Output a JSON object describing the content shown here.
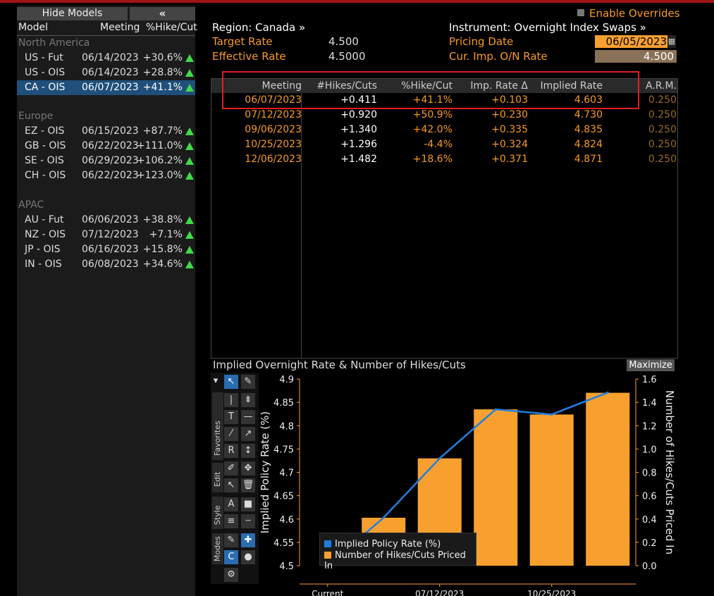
{
  "left": {
    "hide_label": "Hide Models",
    "collapse_label": "«",
    "columns": {
      "model": "Model",
      "meeting": "Meeting",
      "pct": "%Hike/Cut"
    },
    "groups": [
      {
        "name": "North America",
        "rows": [
          {
            "model": "US - Fut",
            "meeting": "06/14/2023",
            "pct": "+30.6%"
          },
          {
            "model": "US - OIS",
            "meeting": "06/14/2023",
            "pct": "+28.8%"
          },
          {
            "model": "CA - OIS",
            "meeting": "06/07/2023",
            "pct": "+41.1%"
          }
        ]
      },
      {
        "name": "Europe",
        "rows": [
          {
            "model": "EZ - OIS",
            "meeting": "06/15/2023",
            "pct": "+87.7%"
          },
          {
            "model": "GB - OIS",
            "meeting": "06/22/2023",
            "pct": "+111.0%"
          },
          {
            "model": "SE - OIS",
            "meeting": "06/29/2023",
            "pct": "+106.2%"
          },
          {
            "model": "CH - OIS",
            "meeting": "06/22/2023",
            "pct": "+123.0%"
          }
        ]
      },
      {
        "name": "APAC",
        "rows": [
          {
            "model": "AU - Fut",
            "meeting": "06/06/2023",
            "pct": "+38.8%"
          },
          {
            "model": "NZ - OIS",
            "meeting": "07/12/2023",
            "pct": "+7.1%"
          },
          {
            "model": "JP - OIS",
            "meeting": "06/16/2023",
            "pct": "+15.8%"
          },
          {
            "model": "IN - OIS",
            "meeting": "06/08/2023",
            "pct": "+34.6%"
          }
        ]
      }
    ]
  },
  "header": {
    "enable_overrides": "Enable Overrides",
    "region": "Region: Canada »",
    "instrument": "Instrument: Overnight Index Swaps »",
    "target_rate_label": "Target Rate",
    "target_rate_value": "4.500",
    "effective_rate_label": "Effective Rate",
    "effective_rate_value": "4.5000",
    "pricing_date_label": "Pricing Date",
    "pricing_date_value": "06/05/2023",
    "cur_imp_label": "Cur. Imp. O/N Rate",
    "cur_imp_value": "4.500"
  },
  "table": {
    "headers": [
      "Meeting",
      "#Hikes/Cuts",
      "%Hike/Cut",
      "Imp. Rate Δ",
      "Implied Rate",
      "A.R.M."
    ],
    "rows": [
      [
        "06/07/2023",
        "+0.411",
        "+41.1%",
        "+0.103",
        "4.603",
        "0.250"
      ],
      [
        "07/12/2023",
        "+0.920",
        "+50.9%",
        "+0.230",
        "4.730",
        "0.250"
      ],
      [
        "09/06/2023",
        "+1.340",
        "+42.0%",
        "+0.335",
        "4.835",
        "0.250"
      ],
      [
        "10/25/2023",
        "+1.296",
        "-4.4%",
        "+0.324",
        "4.824",
        "0.250"
      ],
      [
        "12/06/2023",
        "+1.482",
        "+18.6%",
        "+0.371",
        "4.871",
        "0.250"
      ]
    ]
  },
  "chart_title": "Implied Overnight Rate & Number of Hikes/Cuts",
  "maximize_label": "Maximize",
  "toolbar_tabs": [
    "Favorites",
    "Edit",
    "Style",
    "Modes"
  ],
  "chart_data": {
    "type": "bar",
    "categories": [
      "Current",
      "06/07/2023",
      "07/12/2023",
      "09/06/2023",
      "10/25/2023",
      "12/06/2023"
    ],
    "x_tick_labels": [
      "Current",
      "07/12/2023",
      "10/25/2023"
    ],
    "series": [
      {
        "name": "Implied Policy Rate (%)",
        "type": "line",
        "axis": "left",
        "color": "#1f7fe0",
        "values": [
          4.5,
          4.603,
          4.73,
          4.835,
          4.824,
          4.871
        ]
      },
      {
        "name": "Number of Hikes/Cuts Priced In",
        "type": "bar",
        "axis": "right",
        "color": "#f7a030",
        "values": [
          0.0,
          0.411,
          0.92,
          1.34,
          1.296,
          1.482
        ]
      }
    ],
    "ylabel_left": "Implied Policy Rate (%)",
    "ylabel_right": "Number of Hikes/Cuts Priced In",
    "ylim_left": [
      4.5,
      4.9
    ],
    "ylim_right": [
      0.0,
      1.6
    ],
    "yticks_left": [
      "4.5",
      "4.55",
      "4.6",
      "4.65",
      "4.7",
      "4.75",
      "4.8",
      "4.85",
      "4.9"
    ],
    "yticks_right": [
      "0.0",
      "0.2",
      "0.4",
      "0.6",
      "0.8",
      "1.0",
      "1.2",
      "1.4",
      "1.6"
    ],
    "legend_position": "bottom-left"
  }
}
